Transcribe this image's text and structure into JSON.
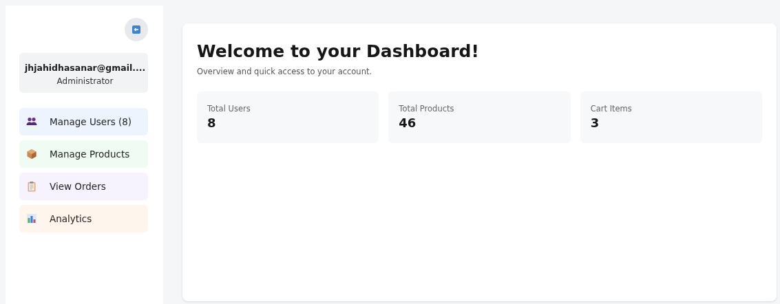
{
  "sidebar": {
    "user": {
      "email": "jhjahidhasanar@gmail....",
      "role": "Administrator"
    },
    "items": [
      {
        "label": "Manage Users (8)",
        "color": "#eef4fe"
      },
      {
        "label": "Manage Products",
        "color": "#effbf3"
      },
      {
        "label": "View Orders",
        "color": "#f7f3fe"
      },
      {
        "label": "Analytics",
        "color": "#fef5ec"
      }
    ]
  },
  "main": {
    "title": "Welcome to your Dashboard!",
    "subtitle": "Overview and quick access to your account.",
    "stats": [
      {
        "label": "Total Users",
        "value": "8"
      },
      {
        "label": "Total Products",
        "value": "46"
      },
      {
        "label": "Cart Items",
        "value": "3"
      }
    ]
  }
}
